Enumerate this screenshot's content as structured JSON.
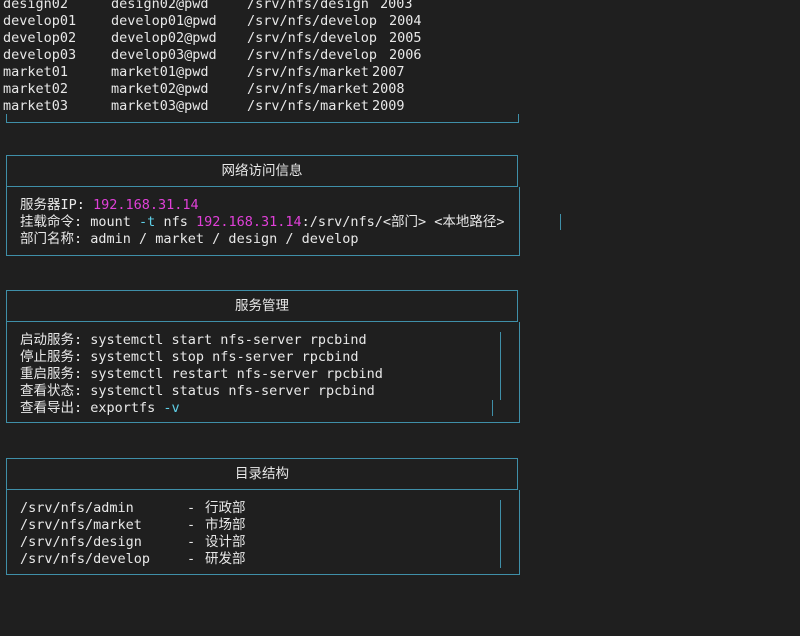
{
  "users": [
    {
      "name": "design02",
      "password": "design02@pwd",
      "path": "/srv/nfs/design",
      "uid": "2003"
    },
    {
      "name": "develop01",
      "password": "develop01@pwd",
      "path": "/srv/nfs/develop",
      "uid": "2004"
    },
    {
      "name": "develop02",
      "password": "develop02@pwd",
      "path": "/srv/nfs/develop",
      "uid": "2005"
    },
    {
      "name": "develop03",
      "password": "develop03@pwd",
      "path": "/srv/nfs/develop",
      "uid": "2006"
    },
    {
      "name": "market01",
      "password": "market01@pwd",
      "path": "/srv/nfs/market",
      "uid": "2007"
    },
    {
      "name": "market02",
      "password": "market02@pwd",
      "path": "/srv/nfs/market",
      "uid": "2008"
    },
    {
      "name": "market03",
      "password": "market03@pwd",
      "path": "/srv/nfs/market",
      "uid": "2009"
    }
  ],
  "network": {
    "title": "网络访问信息",
    "server_label": "服务器IP: ",
    "server_ip": "192.168.31.14",
    "mount_label": "挂载命令: ",
    "mount_cmd": "mount ",
    "mount_flag": "-t",
    "mount_type": " nfs ",
    "mount_ip": "192.168.31.14",
    "mount_path": ":/srv/nfs/<部门> <本地路径>",
    "dept_label": "部门名称: ",
    "dept_value": "admin / market / design / develop"
  },
  "service": {
    "title": "服务管理",
    "items": [
      {
        "label": "启动服务: ",
        "cmd": "systemctl start nfs-server rpcbind",
        "flag": ""
      },
      {
        "label": "停止服务: ",
        "cmd": "systemctl stop nfs-server rpcbind",
        "flag": ""
      },
      {
        "label": "重启服务: ",
        "cmd": "systemctl restart nfs-server rpcbind",
        "flag": ""
      },
      {
        "label": "查看状态: ",
        "cmd": "systemctl status nfs-server rpcbind",
        "flag": ""
      },
      {
        "label": "查看导出: ",
        "cmd": "exportfs ",
        "flag": "-v"
      }
    ]
  },
  "directory": {
    "title": "目录结构",
    "items": [
      {
        "path": "/srv/nfs/admin",
        "sep": "-",
        "desc": "行政部"
      },
      {
        "path": "/srv/nfs/market",
        "sep": "-",
        "desc": "市场部"
      },
      {
        "path": "/srv/nfs/design",
        "sep": "-",
        "desc": "设计部"
      },
      {
        "path": "/srv/nfs/develop",
        "sep": "-",
        "desc": "研发部"
      }
    ]
  },
  "colors": {
    "background": "#1f1f1f",
    "border": "#3f8fa8",
    "ip": "#e040d8",
    "flag": "#5fd0e8",
    "text": "#e8e8e8"
  }
}
